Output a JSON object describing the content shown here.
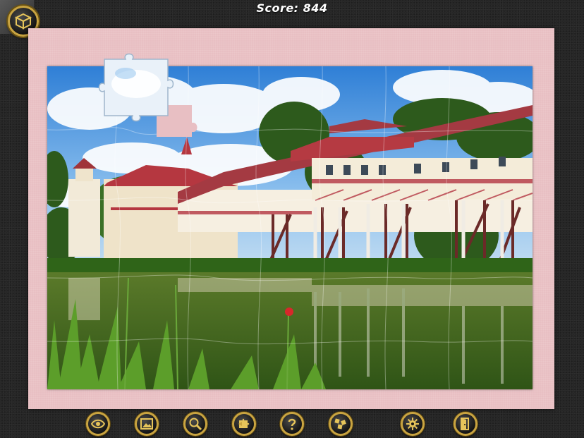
{
  "header": {
    "score_text": "Score: 844"
  },
  "menu_button": {
    "icon": "box-menu-icon"
  },
  "toolbar": {
    "buttons": [
      {
        "name": "preview-button",
        "icon": "eye-icon"
      },
      {
        "name": "background-button",
        "icon": "picture-frame-icon"
      },
      {
        "name": "zoom-button",
        "icon": "magnifier-icon"
      },
      {
        "name": "piece-shape-button",
        "icon": "puzzle-piece-icon"
      },
      {
        "name": "hint-button",
        "icon": "question-mark-icon"
      },
      {
        "name": "edge-pieces-button",
        "icon": "scatter-pieces-icon"
      },
      {
        "name": "settings-button",
        "icon": "gear-icon"
      },
      {
        "name": "exit-button",
        "icon": "door-exit-icon"
      }
    ]
  },
  "colors": {
    "board": "#e8bfc3",
    "button_rim": "#c9a441",
    "background": "#262626"
  }
}
